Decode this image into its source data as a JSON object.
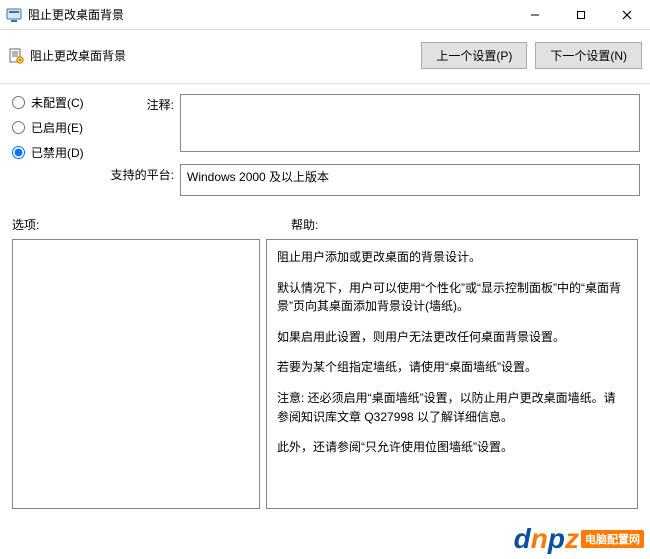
{
  "window": {
    "title": "阻止更改桌面背景"
  },
  "toolbar": {
    "policy_title": "阻止更改桌面背景",
    "prev_label": "上一个设置(P)",
    "next_label": "下一个设置(N)"
  },
  "state_radios": {
    "not_configured": "未配置(C)",
    "enabled": "已启用(E)",
    "disabled": "已禁用(D)",
    "selected": "disabled"
  },
  "fields": {
    "comment_label": "注释:",
    "comment_value": "",
    "platform_label": "支持的平台:",
    "platform_value": "Windows 2000 及以上版本"
  },
  "section_labels": {
    "options": "选项:",
    "help": "帮助:"
  },
  "help_paragraphs": [
    "阻止用户添加或更改桌面的背景设计。",
    "默认情况下，用户可以使用“个性化”或“显示控制面板”中的“桌面背景”页向其桌面添加背景设计(墙纸)。",
    "如果启用此设置，则用户无法更改任何桌面背景设置。",
    "若要为某个组指定墙纸，请使用“桌面墙纸”设置。",
    "注意: 还必须启用“桌面墙纸”设置，以防止用户更改桌面墙纸。请参阅知识库文章 Q327998 以了解详细信息。",
    "此外，还请参阅“只允许使用位图墙纸”设置。"
  ],
  "watermark": {
    "brand": "dnpz",
    "tag": "电脑配置网"
  }
}
